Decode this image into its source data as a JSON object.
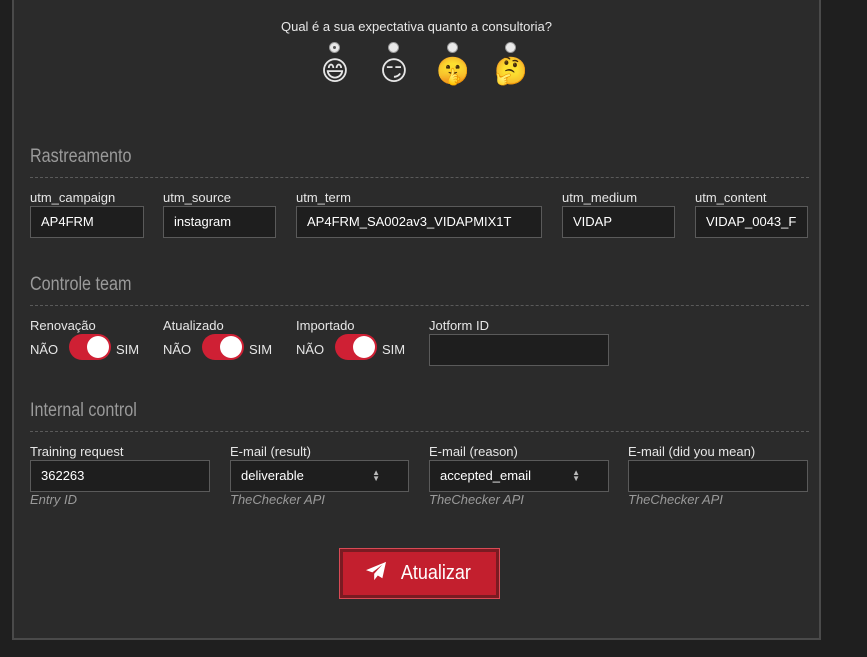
{
  "survey": {
    "question": "Qual é a sua expectativa quanto a consultoria?",
    "options": [
      {
        "emoji": "😄",
        "checked": true
      },
      {
        "emoji": "😏",
        "checked": false
      },
      {
        "emoji": "🤫",
        "checked": false
      },
      {
        "emoji": "🤔",
        "checked": false
      }
    ]
  },
  "tracking": {
    "title": "Rastreamento",
    "fields": [
      {
        "label": "utm_campaign",
        "value": "AP4FRM"
      },
      {
        "label": "utm_source",
        "value": "instagram"
      },
      {
        "label": "utm_term",
        "value": "AP4FRM_SA002av3_VIDAPMIX1T"
      },
      {
        "label": "utm_medium",
        "value": "VIDAP"
      },
      {
        "label": "utm_content",
        "value": "VIDAP_0043_F"
      }
    ]
  },
  "team": {
    "title": "Controle team",
    "toggles": [
      {
        "label": "Renovação",
        "off_text": "NÃO",
        "on_text": "SIM",
        "on": true
      },
      {
        "label": "Atualizado",
        "off_text": "NÃO",
        "on_text": "SIM",
        "on": true
      },
      {
        "label": "Importado",
        "off_text": "NÃO",
        "on_text": "SIM",
        "on": true
      }
    ],
    "jotform": {
      "label": "Jotform ID",
      "value": ""
    }
  },
  "internal": {
    "title": "Internal control",
    "fields": [
      {
        "label": "Training request",
        "value": "362263",
        "hint": "Entry ID"
      },
      {
        "label": "E-mail (result)",
        "value": "deliverable",
        "hint": "TheChecker API"
      },
      {
        "label": "E-mail (reason)",
        "value": "accepted_email",
        "hint": "TheChecker API"
      },
      {
        "label": "E-mail (did you mean)",
        "value": "",
        "hint": "TheChecker API"
      }
    ]
  },
  "actions": {
    "submit_label": "Atualizar",
    "submit_icon": "paper-plane-icon"
  },
  "colors": {
    "accent": "#c31f2e",
    "toggle_on": "#cf2034",
    "panel_bg": "#2b2b2b",
    "page_bg": "#1f1f1f"
  }
}
